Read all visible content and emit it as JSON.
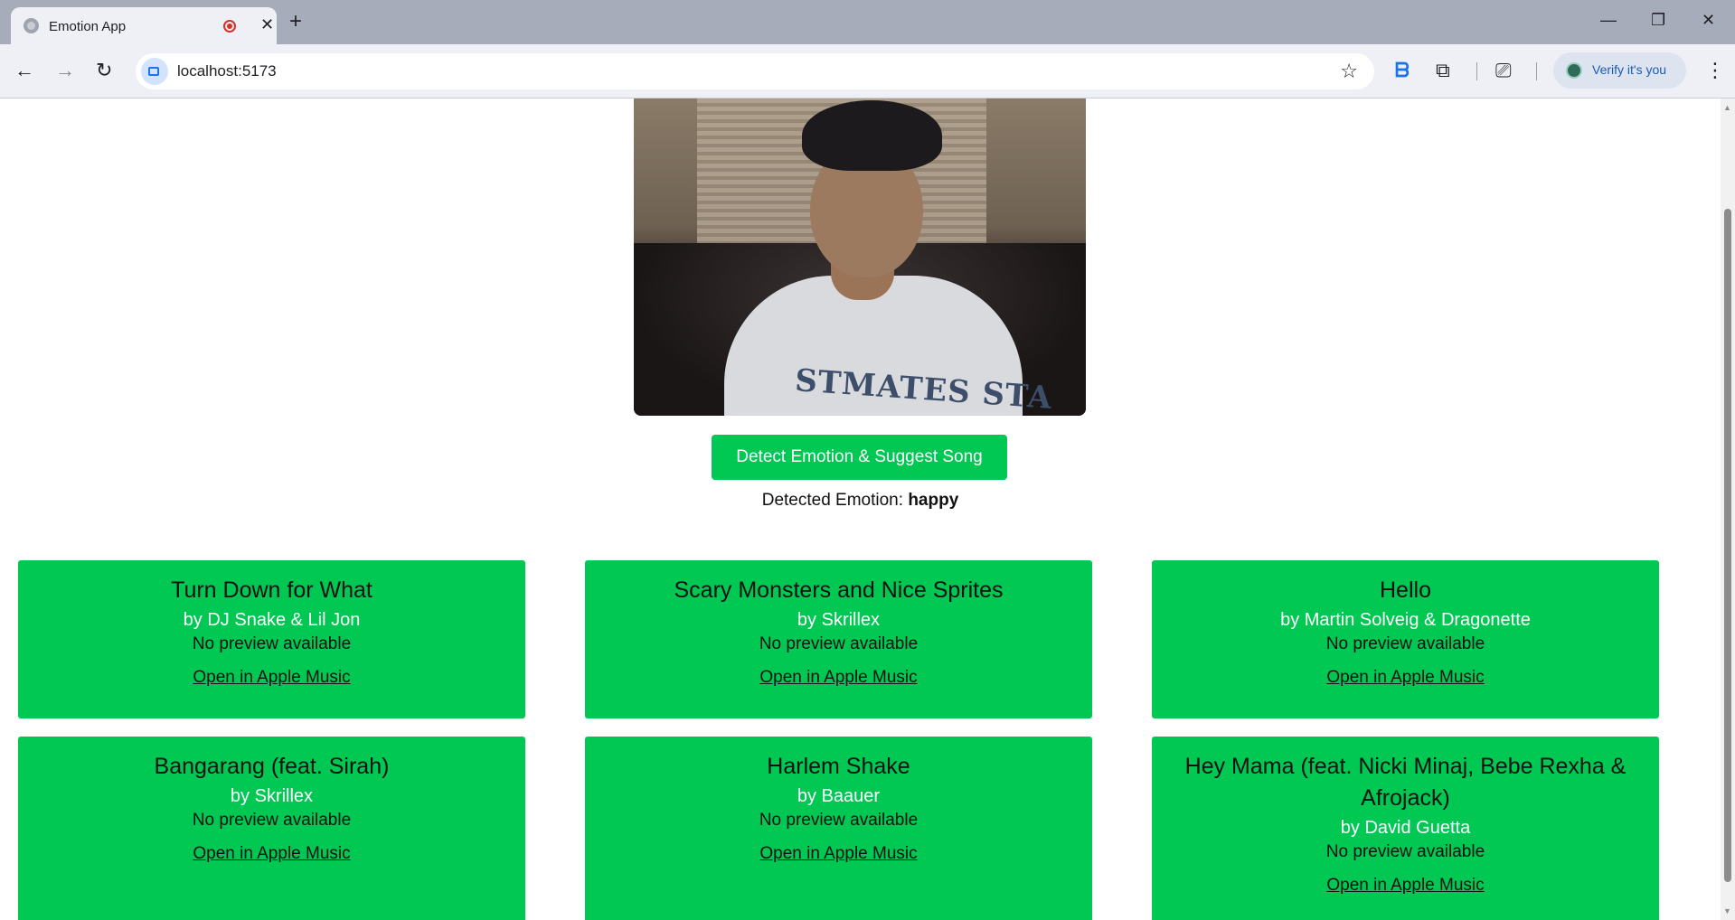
{
  "browser": {
    "tab_title": "Emotion App",
    "url": "localhost:5173",
    "profile_label": "Verify it's you"
  },
  "page": {
    "button_label": "Detect Emotion & Suggest Song",
    "emotion_label": "Detected Emotion:",
    "emotion_value": "happy",
    "webcam_shirt_text": "STMATES STA"
  },
  "songs": [
    {
      "title": "Turn Down for What",
      "artist": "by DJ Snake & Lil Jon",
      "preview": "No preview available",
      "link": "Open in Apple Music"
    },
    {
      "title": "Scary Monsters and Nice Sprites",
      "artist": "by Skrillex",
      "preview": "No preview available",
      "link": "Open in Apple Music"
    },
    {
      "title": "Hello",
      "artist": "by Martin Solveig & Dragonette",
      "preview": "No preview available",
      "link": "Open in Apple Music"
    },
    {
      "title": "Bangarang (feat. Sirah)",
      "artist": "by Skrillex",
      "preview": "No preview available",
      "link": "Open in Apple Music"
    },
    {
      "title": "Harlem Shake",
      "artist": "by Baauer",
      "preview": "No preview available",
      "link": "Open in Apple Music"
    },
    {
      "title": "Hey Mama (feat. Nicki Minaj, Bebe Rexha & Afrojack)",
      "artist": "by David Guetta",
      "preview": "No preview available",
      "link": "Open in Apple Music"
    }
  ],
  "colors": {
    "accent": "#00c853",
    "tabstrip": "#a6acba",
    "toolbar": "#eef0f6"
  }
}
